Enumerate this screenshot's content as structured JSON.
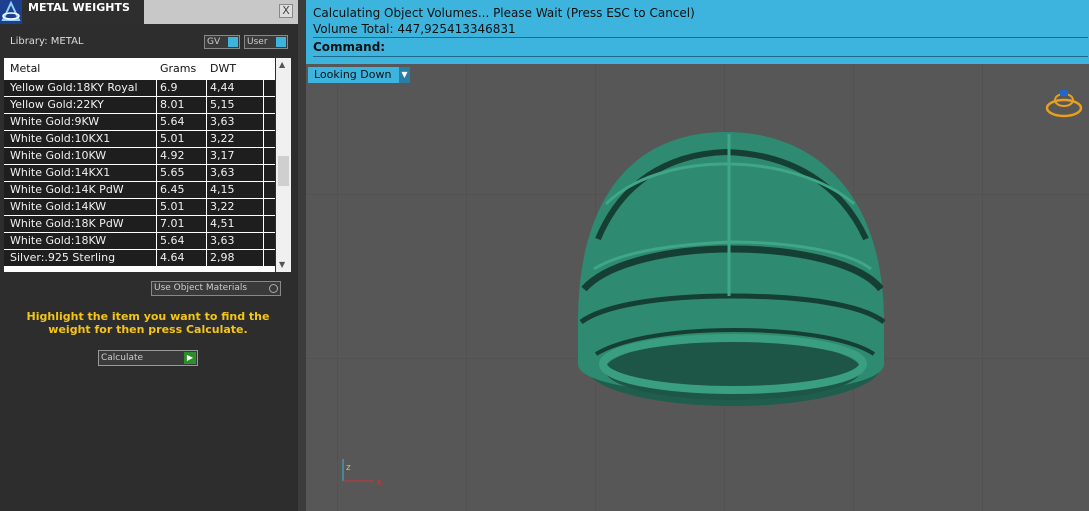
{
  "panel": {
    "title": "METAL WEIGHTS",
    "close_label": "X",
    "library_label": "Library: METAL",
    "toggle_gv": "GV",
    "toggle_user": "User",
    "columns": [
      "Metal",
      "Grams",
      "DWT"
    ],
    "rows": [
      {
        "metal": "Yellow Gold:18KY Royal",
        "grams": "6.9",
        "dwt": "4,44"
      },
      {
        "metal": "Yellow Gold:22KY",
        "grams": "8.01",
        "dwt": "5,15"
      },
      {
        "metal": "White Gold:9KW",
        "grams": "5.64",
        "dwt": "3,63"
      },
      {
        "metal": "White Gold:10KX1",
        "grams": "5.01",
        "dwt": "3,22"
      },
      {
        "metal": "White Gold:10KW",
        "grams": "4.92",
        "dwt": "3,17"
      },
      {
        "metal": "White Gold:14KX1",
        "grams": "5.65",
        "dwt": "3,63"
      },
      {
        "metal": "White Gold:14K PdW",
        "grams": "6.45",
        "dwt": "4,15"
      },
      {
        "metal": "White Gold:14KW",
        "grams": "5.01",
        "dwt": "3,22"
      },
      {
        "metal": "White Gold:18K PdW",
        "grams": "7.01",
        "dwt": "4,51"
      },
      {
        "metal": "White Gold:18KW",
        "grams": "5.64",
        "dwt": "3,63"
      },
      {
        "metal": "Silver:.925 Sterling",
        "grams": "4.64",
        "dwt": "2,98"
      }
    ],
    "use_object_materials": "Use Object Materials",
    "hint": "Highlight the item you want to find the weight for then press Calculate.",
    "calculate_label": "Calculate"
  },
  "command": {
    "line1": "Calculating Object Volumes... Please Wait (Press ESC to Cancel)",
    "line2": "Volume Total: 447,925413346831",
    "prompt": "Command:"
  },
  "viewport": {
    "view_label": "Looking Down",
    "axis_x": "x",
    "axis_z": "z",
    "ring_color": "#2e8a70"
  }
}
